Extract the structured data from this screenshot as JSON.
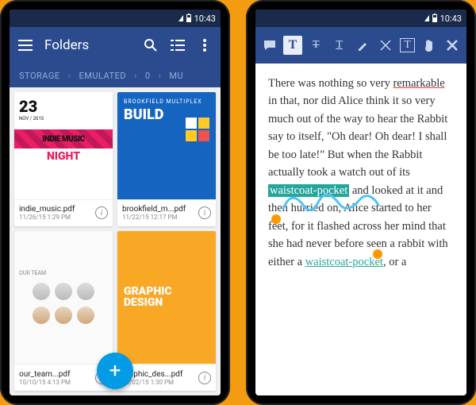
{
  "status": {
    "time": "10:43"
  },
  "left": {
    "title": "Folders",
    "breadcrumb": [
      "STORAGE",
      "EMULATED",
      "0",
      "MU"
    ],
    "files": [
      {
        "name": "indie_music.pdf",
        "date": "11/26/15 1:29 PM"
      },
      {
        "name": "brookfield_m...pdf",
        "date": "11/22/15 12:17 PM"
      },
      {
        "name": "our_team...pdf",
        "date": "10/10/15 4:13 PM"
      },
      {
        "name": "graphic_des...pdf",
        "date": "10/02/15 1:30 PM"
      }
    ],
    "thumbs": {
      "indie": {
        "date_num": "23",
        "date_sub": "NOV / 2015",
        "line1": "INDIE MUSIC",
        "line2": "NIGHT"
      },
      "brook": {
        "label": "BROOKFIELD MULTIPLEX",
        "word": "BUILD"
      },
      "team": {
        "heading": "OUR TEAM"
      },
      "graphic": {
        "line1": "GRAPHIC",
        "line2": "DESIGN"
      }
    }
  },
  "right": {
    "text": {
      "p1a": "There was nothing so very ",
      "remarkable": "remarkable",
      "p1b": " in that, nor did Alice think it so very much out of the way to hear the Rabbit say to itself, \"Oh dear! Oh dear! I shall be too late!\" But when the Rabbit actually took a watch out of its ",
      "waistcoat": "waistcoat-pocket",
      "p1c": " and looked at it and then hurried on, Alice started to her feet, for it flashed across her mind that she had never before seen a rabbit with either a ",
      "waistcoat2": "waistcoat-pocket",
      "p1d": ", or a"
    }
  }
}
